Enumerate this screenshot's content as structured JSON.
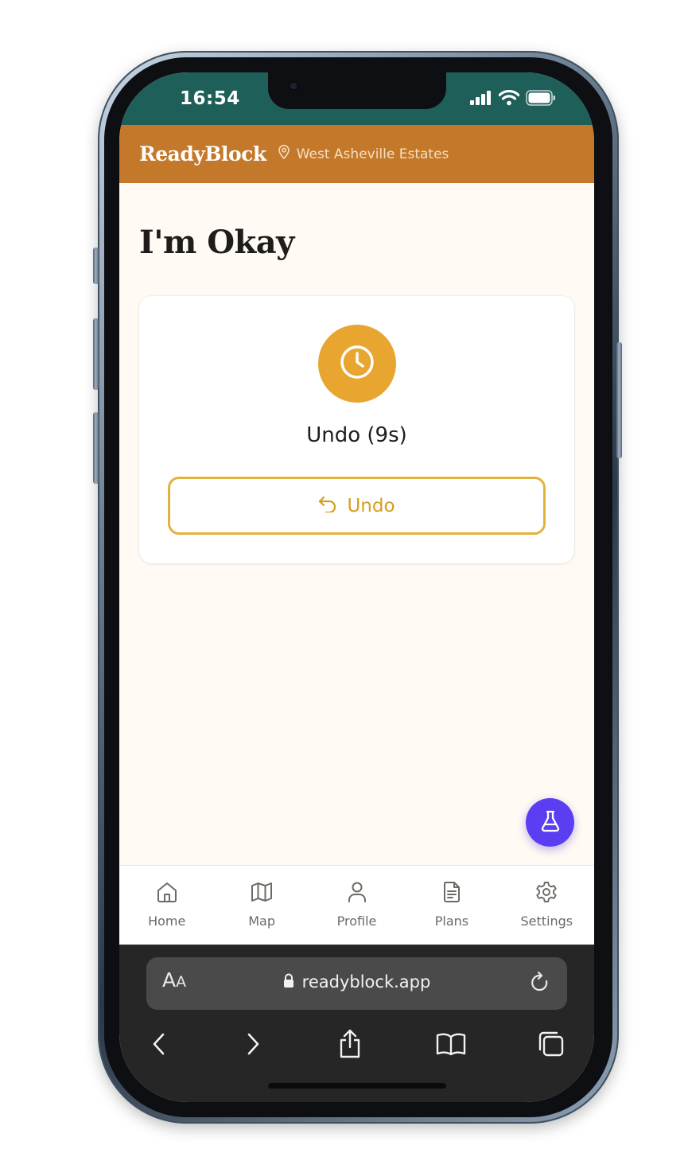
{
  "status_bar": {
    "time": "16:54"
  },
  "header": {
    "brand": "ReadyBlock",
    "location": "West Asheville Estates"
  },
  "page": {
    "title": "I'm Okay"
  },
  "card": {
    "status_text": "Undo (9s)",
    "undo_button_label": "Undo"
  },
  "bottom_nav": {
    "items": [
      {
        "label": "Home",
        "icon": "home-icon"
      },
      {
        "label": "Map",
        "icon": "map-icon"
      },
      {
        "label": "Profile",
        "icon": "user-icon"
      },
      {
        "label": "Plans",
        "icon": "document-icon"
      },
      {
        "label": "Settings",
        "icon": "gear-icon"
      }
    ]
  },
  "browser": {
    "aa_label_large": "A",
    "aa_label_small": "A",
    "url": "readyblock.app"
  },
  "colors": {
    "status_bar": "#1f5f5a",
    "header": "#c4782a",
    "accent": "#e8a530",
    "fab": "#5b3ef2",
    "background": "#fffbf4"
  }
}
